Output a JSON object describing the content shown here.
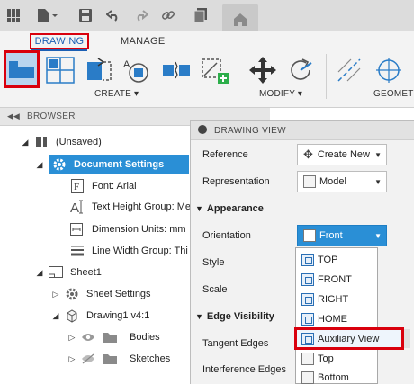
{
  "ribbon": {
    "tabs": {
      "drawing": "DRAWING",
      "manage": "MANAGE"
    },
    "groups": {
      "create": "CREATE ▾",
      "modify": "MODIFY ▾",
      "geometry": "GEOMET"
    }
  },
  "browser": {
    "header": "BROWSER",
    "tree": {
      "root": "(Unsaved)",
      "doc_settings": "Document Settings",
      "font": "Font: Arial",
      "text_height": "Text Height Group: Me",
      "dim_units": "Dimension Units: mm",
      "line_width": "Line Width Group: Thi",
      "sheet1": "Sheet1",
      "sheet_settings": "Sheet Settings",
      "drawing1": "Drawing1 v4:1",
      "bodies": "Bodies",
      "sketches": "Sketches"
    }
  },
  "panel": {
    "title": "DRAWING VIEW",
    "reference_label": "Reference",
    "reference_value": "Create New",
    "representation_label": "Representation",
    "representation_value": "Model",
    "appearance": "Appearance",
    "orientation_label": "Orientation",
    "orientation_value": "Front",
    "style_label": "Style",
    "scale_label": "Scale",
    "edge_visibility": "Edge Visibility",
    "tangent_label": "Tangent Edges",
    "interference_label": "Interference Edges"
  },
  "orientation_menu": [
    "TOP",
    "FRONT",
    "RIGHT",
    "HOME",
    "Auxiliary View",
    "Top",
    "Bottom"
  ],
  "colors": {
    "accent": "#2a8fd6",
    "highlight": "#d9000d"
  }
}
